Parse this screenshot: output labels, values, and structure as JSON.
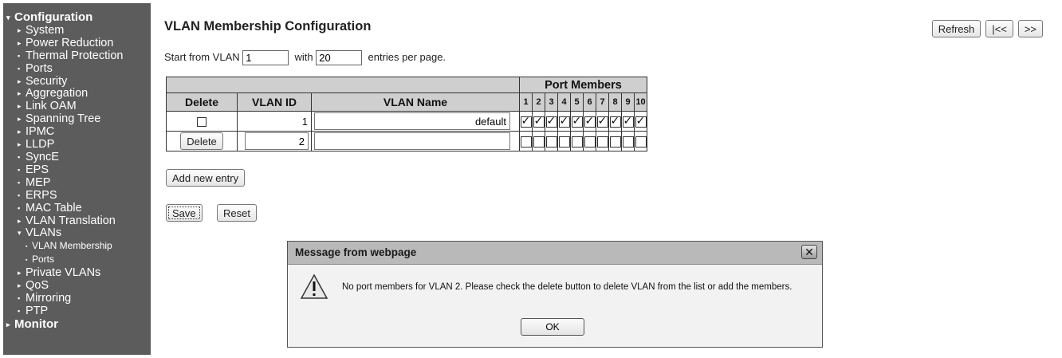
{
  "sidebar": {
    "items": [
      {
        "label": "Configuration",
        "marker": "▾",
        "level": "top"
      },
      {
        "label": "System",
        "marker": "▸",
        "level": "l1"
      },
      {
        "label": "Power Reduction",
        "marker": "▸",
        "level": "l1"
      },
      {
        "label": "Thermal Protection",
        "marker": "▪",
        "level": "l1"
      },
      {
        "label": "Ports",
        "marker": "▪",
        "level": "l1"
      },
      {
        "label": "Security",
        "marker": "▸",
        "level": "l1"
      },
      {
        "label": "Aggregation",
        "marker": "▸",
        "level": "l1"
      },
      {
        "label": "Link OAM",
        "marker": "▸",
        "level": "l1"
      },
      {
        "label": "Spanning Tree",
        "marker": "▸",
        "level": "l1"
      },
      {
        "label": "IPMC",
        "marker": "▸",
        "level": "l1"
      },
      {
        "label": "LLDP",
        "marker": "▸",
        "level": "l1"
      },
      {
        "label": "SyncE",
        "marker": "▪",
        "level": "l1"
      },
      {
        "label": "EPS",
        "marker": "▪",
        "level": "l1"
      },
      {
        "label": "MEP",
        "marker": "▪",
        "level": "l1"
      },
      {
        "label": "ERPS",
        "marker": "▪",
        "level": "l1"
      },
      {
        "label": "MAC Table",
        "marker": "▪",
        "level": "l1"
      },
      {
        "label": "VLAN Translation",
        "marker": "▸",
        "level": "l1"
      },
      {
        "label": "VLANs",
        "marker": "▾",
        "level": "l1"
      },
      {
        "label": "VLAN Membership",
        "marker": "▪",
        "level": "l2"
      },
      {
        "label": "Ports",
        "marker": "▪",
        "level": "l2"
      },
      {
        "label": "Private VLANs",
        "marker": "▸",
        "level": "l1"
      },
      {
        "label": "QoS",
        "marker": "▸",
        "level": "l1"
      },
      {
        "label": "Mirroring",
        "marker": "▪",
        "level": "l1"
      },
      {
        "label": "PTP",
        "marker": "▪",
        "level": "l1"
      },
      {
        "label": "Monitor",
        "marker": "▸",
        "level": "top"
      }
    ]
  },
  "page": {
    "title": "VLAN Membership Configuration",
    "refresh_label": "Refresh",
    "first_label": "|<<",
    "next_label": ">>"
  },
  "paging": {
    "start_text": "Start from VLAN",
    "start_value": "1",
    "with_text": "with",
    "entries_value": "20",
    "per_page_text": "entries per page."
  },
  "table": {
    "port_members_header": "Port Members",
    "delete_header": "Delete",
    "vlan_id_header": "VLAN ID",
    "vlan_name_header": "VLAN Name",
    "ports": [
      "1",
      "2",
      "3",
      "4",
      "5",
      "6",
      "7",
      "8",
      "9",
      "10"
    ],
    "rows": [
      {
        "vlan_id": "1",
        "vlan_name": "default",
        "delete": "checkbox",
        "members": [
          true,
          true,
          true,
          true,
          true,
          true,
          true,
          true,
          true,
          true
        ]
      },
      {
        "vlan_id": "2",
        "vlan_name": "",
        "delete": "Delete",
        "members": [
          false,
          false,
          false,
          false,
          false,
          false,
          false,
          false,
          false,
          false
        ]
      }
    ]
  },
  "actions": {
    "add_new_entry_label": "Add new entry",
    "save_label": "Save",
    "reset_label": "Reset"
  },
  "dialog": {
    "title": "Message from webpage",
    "close_glyph": "✕",
    "message": "No port members for VLAN 2. Please check the delete button to delete VLAN from the list or add the members.",
    "ok_label": "OK",
    "icon": "warning-icon"
  }
}
